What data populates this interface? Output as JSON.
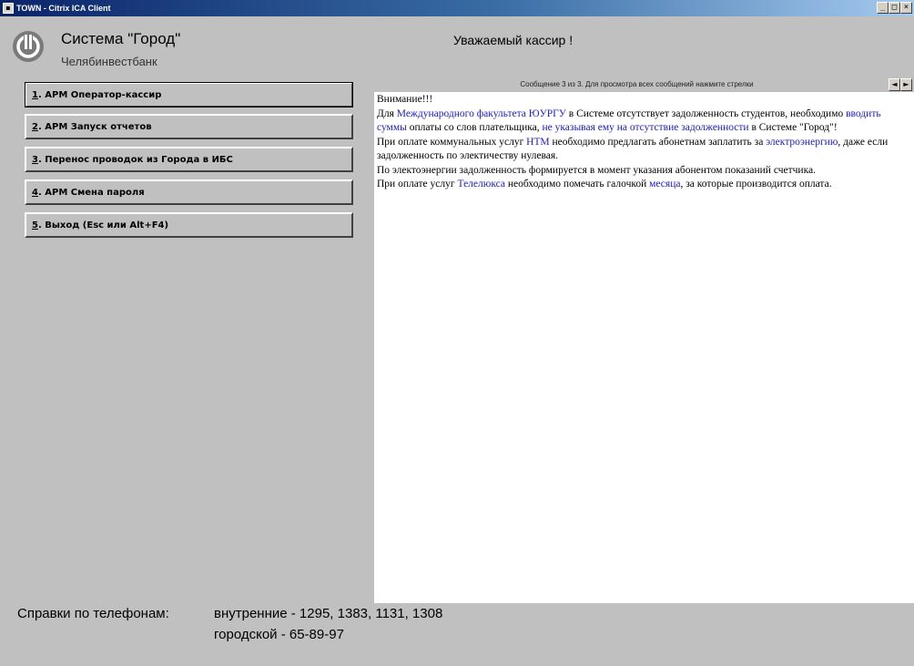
{
  "window": {
    "title": "TOWN - Citrix ICA Client",
    "buttons": [
      "_",
      "□",
      "×"
    ]
  },
  "header": {
    "system_title": "Система \"Город\"",
    "bank_name": "Челябинвестбанк",
    "greeting": "Уважаемый кассир !"
  },
  "menu": {
    "items": [
      {
        "num": "1",
        "text": ". АРМ Оператор-кассир"
      },
      {
        "num": "2",
        "text": ". АРМ Запуск отчетов"
      },
      {
        "num": "3",
        "text": ". Перенос проводок из Города в ИБС"
      },
      {
        "num": "4",
        "text": ". АРМ Смена пароля"
      },
      {
        "num": "5",
        "text": ". Выход   (Esc или Alt+F4)"
      }
    ]
  },
  "messages": {
    "header": "Сообщение 3 из 3. Для просмотра всех сообщений нажмите стрелки",
    "prev_arrow": "◄",
    "next_arrow": "►",
    "segments": [
      {
        "t": "Внимание!!!",
        "c": "n",
        "br": true
      },
      {
        "t": "Для ",
        "c": "n"
      },
      {
        "t": "Международного факультета ЮУРГУ",
        "c": "b"
      },
      {
        "t": " в Системе отсутствует задолженность студентов, необходимо ",
        "c": "n"
      },
      {
        "t": "вводить суммы",
        "c": "b"
      },
      {
        "t": " оплаты со слов плательщика, ",
        "c": "n"
      },
      {
        "t": "не указывая ему на отсутствие задолженности",
        "c": "b"
      },
      {
        "t": " в Системе \"Город\"!",
        "c": "n",
        "br": true
      },
      {
        "t": "При оплате коммунальных услуг ",
        "c": "n"
      },
      {
        "t": "НТМ",
        "c": "b"
      },
      {
        "t": " необходимо предлагать абонетнам заплатить за ",
        "c": "n"
      },
      {
        "t": "электроэнергию",
        "c": "b"
      },
      {
        "t": ", даже если задолженность по электичеству нулевая.",
        "c": "n",
        "br": true
      },
      {
        "t": "По электоэнергии задолженность формируется в момент указания абонентом показаний счетчика.",
        "c": "n",
        "br": true
      },
      {
        "t": "При оплате услуг ",
        "c": "n"
      },
      {
        "t": "Телелюкса",
        "c": "b"
      },
      {
        "t": " необходимо помечать галочкой ",
        "c": "n"
      },
      {
        "t": "месяца",
        "c": "b"
      },
      {
        "t": ", за которые производится оплата.",
        "c": "n"
      }
    ]
  },
  "footer": {
    "label": "Справки по телефонам:",
    "internal": "внутренние - 1295, 1383, 1131, 1308",
    "city": "городской   - 65-89-97"
  },
  "colors": {
    "background": "#c0c0c0",
    "highlight_text": "#1a1adc",
    "title_bar": "#0a246a"
  }
}
